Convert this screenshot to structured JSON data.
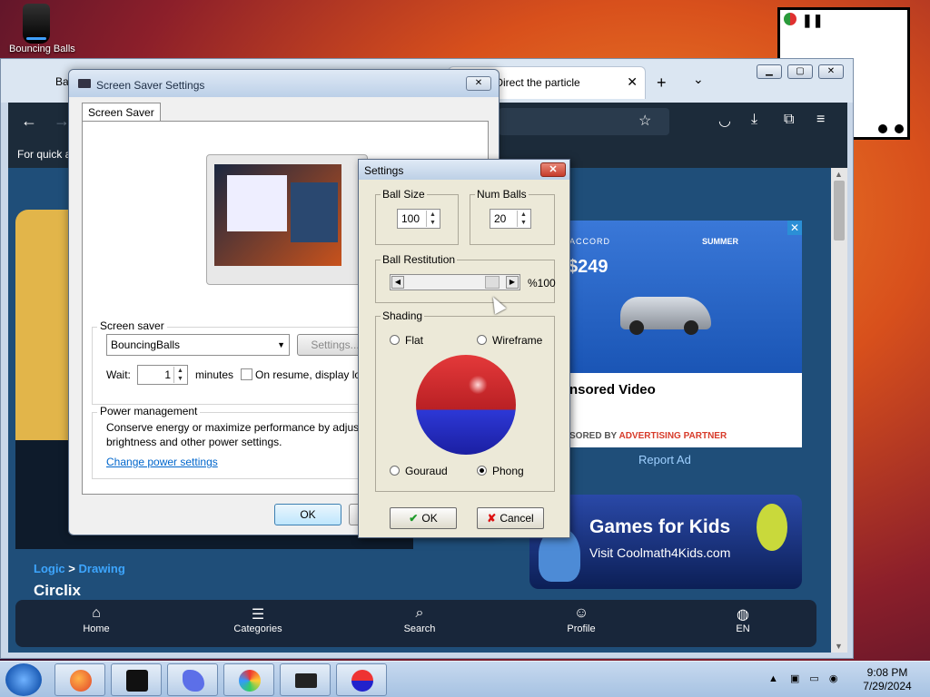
{
  "desktop": {
    "icon_label": "Bouncing Balls"
  },
  "browser": {
    "tabs": [
      {
        "label": "Bal"
      },
      {
        "label": "Circlix: Direct the particle"
      }
    ],
    "quick_hint": "For quick a",
    "breadcrumb": {
      "parent": "Logic",
      "separator": ">",
      "child": "Drawing"
    },
    "game_title": "Circlix",
    "ad": {
      "brand": "ACCORD",
      "promo": "SUMMER",
      "price": "$249",
      "sponsored": "nsored Video",
      "by_prefix": "SORED BY",
      "partner": "ADVERTISING PARTNER"
    },
    "report_ad": "Report Ad",
    "kids_banner": {
      "title": "Games for Kids",
      "subtitle": "Visit Coolmath4Kids.com"
    },
    "bottom_nav": [
      {
        "label": "Home",
        "icon": "home-icon"
      },
      {
        "label": "Categories",
        "icon": "categories-icon"
      },
      {
        "label": "Search",
        "icon": "search-icon"
      },
      {
        "label": "Profile",
        "icon": "profile-icon"
      },
      {
        "label": "EN",
        "icon": "globe-icon"
      }
    ]
  },
  "screensaver_dialog": {
    "title": "Screen Saver Settings",
    "tab": "Screen Saver",
    "group_label": "Screen saver",
    "selected": "BouncingBalls",
    "settings_button": "Settings...",
    "wait_label": "Wait:",
    "wait_value": "1",
    "minutes_label": "minutes",
    "resume_label": "On resume, display lo",
    "power_label": "Power management",
    "power_text_1": "Conserve energy or maximize performance by adjust",
    "power_text_2": "brightness and other power settings.",
    "power_link": "Change power settings",
    "ok": "OK"
  },
  "settings_dialog": {
    "title": "Settings",
    "ball_size_label": "Ball Size",
    "ball_size": "100",
    "num_balls_label": "Num Balls",
    "num_balls": "20",
    "restitution_label": "Ball Restitution",
    "restitution_value": "%100",
    "shading_label": "Shading",
    "shading_options": {
      "flat": "Flat",
      "wireframe": "Wireframe",
      "gouraud": "Gouraud",
      "phong": "Phong"
    },
    "ok": "OK",
    "cancel": "Cancel"
  },
  "taskbar": {
    "time": "9:08 PM",
    "date": "7/29/2024"
  }
}
